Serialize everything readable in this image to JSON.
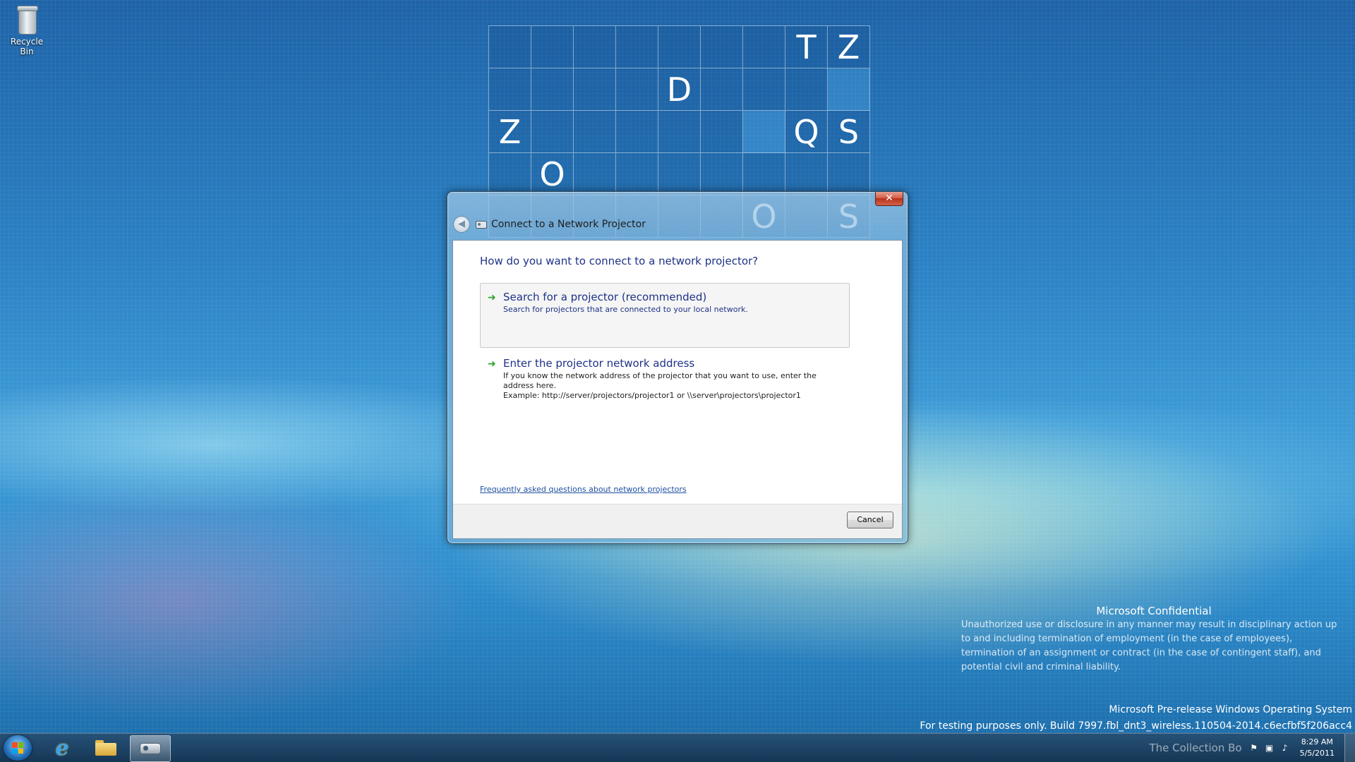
{
  "desktop": {
    "icons": [
      {
        "label": "Recycle Bin",
        "icon": "recycle-bin-icon"
      }
    ]
  },
  "letter_grid": {
    "rows": [
      [
        "",
        "",
        "",
        "",
        "",
        "",
        "",
        "T",
        "Z"
      ],
      [
        "",
        "",
        "",
        "",
        "D",
        "",
        "",
        "",
        ""
      ],
      [
        "Z",
        "",
        "",
        "",
        "",
        "",
        "",
        "Q",
        "S"
      ],
      [
        "",
        "O",
        "",
        "",
        "",
        "",
        "",
        "",
        ""
      ],
      [
        "",
        "",
        "",
        "",
        "",
        "",
        "O",
        "",
        "S"
      ]
    ]
  },
  "dialog": {
    "title": "Connect to a Network Projector",
    "close_label": "✕",
    "back_label": "◀",
    "heading": "How do you want to connect to a network projector?",
    "options": [
      {
        "title": "Search for a projector (recommended)",
        "description": "Search for projectors that are connected to your local network."
      },
      {
        "title": "Enter the projector network address",
        "description": "If you know the network address of the projector that you want to use, enter the address here.",
        "example": "Example: http://server/projectors/projector1 or \\\\server\\projectors\\projector1"
      }
    ],
    "faq_link": "Frequently asked questions about network projectors",
    "cancel_label": "Cancel"
  },
  "watermark": {
    "title": "Microsoft Confidential",
    "body": "Unauthorized use or disclosure in any manner may result in disciplinary action up to and including termination of employment (in the case of employees), termination of an assignment or contract (in the case of contingent staff), and potential civil and criminal liability.",
    "os_line": "Microsoft Pre-release Windows Operating System",
    "build_line": "For testing purposes only. Build 7997.fbl_dnt3_wireless.110504-2014.c6ecfbf5f206acc4"
  },
  "taskbar": {
    "pinned": [
      {
        "name": "internet-explorer",
        "icon": "internet-explorer-icon"
      },
      {
        "name": "windows-explorer",
        "icon": "folder-icon"
      },
      {
        "name": "network-projector",
        "icon": "projector-icon",
        "active": true
      }
    ],
    "tray": {
      "overlay_text": "The Collection Bo",
      "time": "8:29 AM",
      "date": "5/5/2011"
    }
  }
}
